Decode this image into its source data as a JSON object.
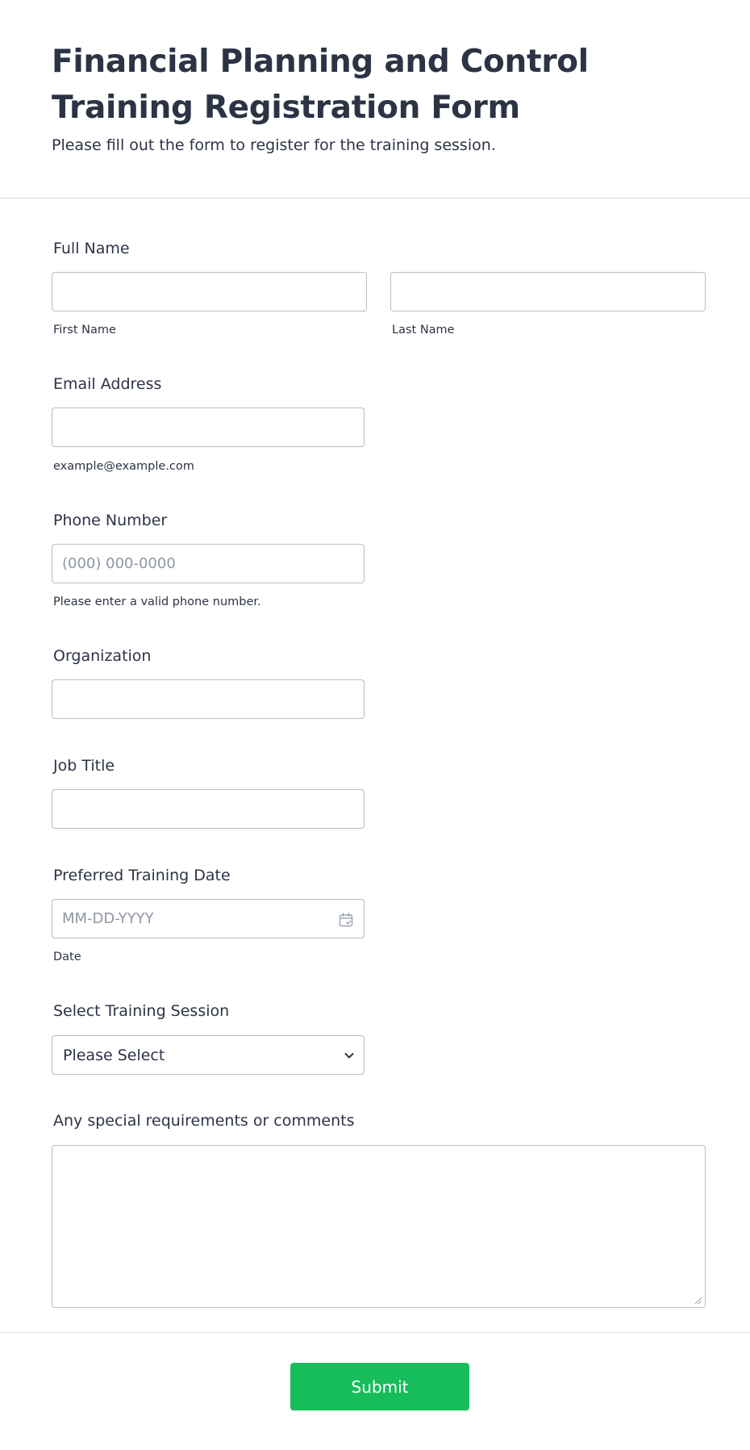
{
  "header": {
    "title": "Financial Planning and Control Training Registration Form",
    "subtitle": "Please fill out the form to register for the training session."
  },
  "fields": {
    "full_name": {
      "label": "Full Name",
      "first_sublabel": "First Name",
      "last_sublabel": "Last Name",
      "first_value": "",
      "last_value": ""
    },
    "email": {
      "label": "Email Address",
      "value": "",
      "sublabel": "example@example.com"
    },
    "phone": {
      "label": "Phone Number",
      "placeholder": "(000) 000-0000",
      "sublabel": "Please enter a valid phone number."
    },
    "organization": {
      "label": "Organization",
      "value": ""
    },
    "job_title": {
      "label": "Job Title",
      "value": ""
    },
    "training_date": {
      "label": "Preferred Training Date",
      "placeholder": "MM-DD-YYYY",
      "sublabel": "Date",
      "icon": "calendar-icon"
    },
    "training_session": {
      "label": "Select Training Session",
      "selected": "Please Select",
      "icon": "chevron-down-icon"
    },
    "comments": {
      "label": "Any special requirements or comments",
      "value": ""
    }
  },
  "submit": {
    "label": "Submit",
    "color": "#18bd5b"
  },
  "colors": {
    "text": "#2c3345",
    "border": "#b8bdc9",
    "placeholder": "#8f96a3"
  }
}
